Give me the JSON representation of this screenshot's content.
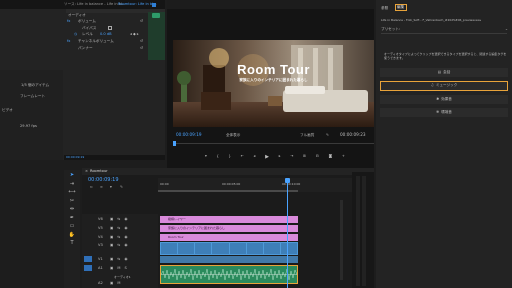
{
  "effect_controls": {
    "tab_label": "ソース: Life in balance - Life in bl...",
    "tab_active": "Roomtour: Life in bl...",
    "section_audio": "オーディオ",
    "rows": [
      "ボリューム",
      "バイパス",
      "レベル",
      "チャンネルボリューム",
      "パンナー"
    ],
    "level_value": "0.0 dB",
    "timecode": "00:00:09:19",
    "fx_badge": "fx"
  },
  "project_panel": {
    "items_label": "1/5 個のアイテム",
    "frame_label": "フレームレート",
    "col1": "ビデオ",
    "col2": "29.97 fps"
  },
  "program_monitor": {
    "title_text": "Room Tour",
    "subtitle_text": "家族に入りのインテリアに囲まれた暮らし",
    "timecode_left": "00:00:09:19",
    "fit_label": "全体表示",
    "quality_label": "フル画質",
    "timecode_right": "00:00:09:23"
  },
  "essential_sound": {
    "tab_edit": "編集",
    "tab_browse": "参照",
    "clip_name": "Life in Balance - Folk_Soft - F_Vahrenbach_#2025#06_preview.wav",
    "preset_label": "プリセット:",
    "prompt_text": "オーディオタイプによってクリップを選択できるタイプを選択すると、関連する編集タグを使うできます。",
    "type_buttons": [
      {
        "label": "会話",
        "icon": "dialogue-icon",
        "active": false
      },
      {
        "label": "ミュージック",
        "icon": "music-icon",
        "active": true
      },
      {
        "label": "効果音",
        "icon": "sfx-icon",
        "active": false
      },
      {
        "label": "環境音",
        "icon": "ambience-icon",
        "active": false
      }
    ],
    "accent_color": "#e8a33a"
  },
  "timeline": {
    "sequence_name": "Roomtour",
    "timecode": "00:00:09:19",
    "ruler_labels": [
      "00:00",
      "00:00:05:00",
      "00:00:10:00"
    ],
    "tracks": [
      {
        "name": "V6",
        "clip": "縦横レイヤー",
        "type": "video"
      },
      {
        "name": "V5",
        "clip": "家族に入りのインテリアに囲まれた暮らし",
        "type": "video"
      },
      {
        "name": "V4",
        "clip": "Room Tour",
        "type": "video"
      },
      {
        "name": "V3",
        "clip": "",
        "type": "video"
      },
      {
        "name": "V2",
        "clip": "",
        "type": "video"
      },
      {
        "name": "V1",
        "clip": "",
        "type": "video"
      },
      {
        "name": "A1",
        "clip": "",
        "type": "audio"
      },
      {
        "name": "A2",
        "clip": "",
        "type": "audio"
      },
      {
        "name": "A3",
        "clip": "",
        "type": "audio"
      }
    ],
    "audio_track_label": "オーディオ1",
    "colors": {
      "title_clip": "#d98adb",
      "video_clip": "#4f9ad8",
      "audio_clip": "#2a8a5c",
      "playhead": "#4aa3ff"
    }
  },
  "tools": [
    "selection-tool",
    "track-select-tool",
    "ripple-edit-tool",
    "razor-tool",
    "slip-tool",
    "pen-tool",
    "rectangle-tool",
    "hand-tool",
    "type-tool"
  ]
}
